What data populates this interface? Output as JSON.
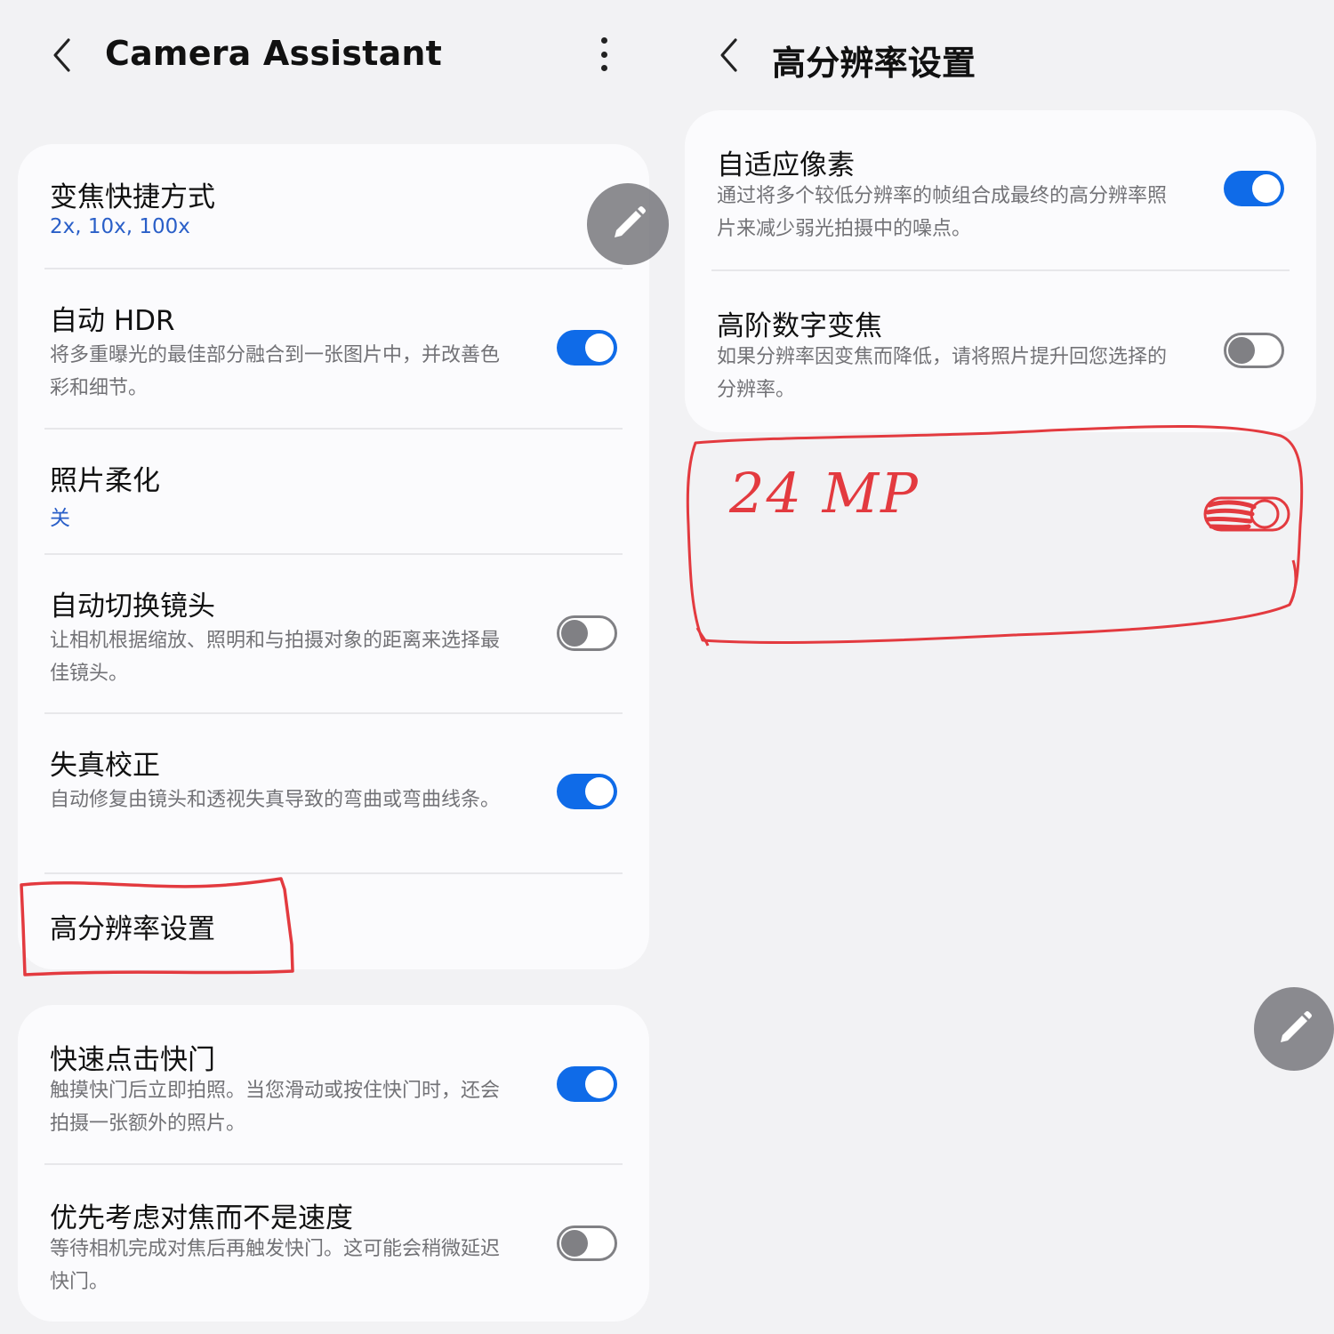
{
  "left": {
    "header": {
      "title": "Camera Assistant"
    },
    "card1": {
      "zoom": {
        "title": "变焦快捷方式",
        "value": "2x, 10x, 100x"
      },
      "hdr": {
        "title": "自动 HDR",
        "desc": "将多重曝光的最佳部分融合到一张图片中，并改善色彩和细节。",
        "toggle": "on"
      },
      "soften": {
        "title": "照片柔化",
        "value": "关"
      },
      "lens": {
        "title": "自动切换镜头",
        "desc": "让相机根据缩放、照明和与拍摄对象的距离来选择最佳镜头。",
        "toggle": "off"
      },
      "distortion": {
        "title": "失真校正",
        "desc": "自动修复由镜头和透视失真导致的弯曲或弯曲线条。",
        "toggle": "on"
      },
      "hires": {
        "title": "高分辨率设置"
      }
    },
    "card2": {
      "quick_shutter": {
        "title": "快速点击快门",
        "desc": "触摸快门后立即拍照。当您滑动或按住快门时，还会拍摄一张额外的照片。",
        "toggle": "on"
      },
      "focus_priority": {
        "title": "优先考虑对焦而不是速度",
        "desc": "等待相机完成对焦后再触发快门。这可能会稍微延迟快门。",
        "toggle": "off"
      }
    }
  },
  "right": {
    "header": {
      "title": "高分辨率设置"
    },
    "card": {
      "adaptive": {
        "title": "自适应像素",
        "desc": "通过将多个较低分辨率的帧组合成最终的高分辨率照片来减少弱光拍摄中的噪点。",
        "toggle": "on"
      },
      "digital_zoom": {
        "title": "高阶数字变焦",
        "desc": "如果分辨率因变焦而降低，请将照片提升回您选择的分辨率。",
        "toggle": "off"
      }
    },
    "annotation": {
      "text": "24 MP"
    }
  },
  "colors": {
    "accent": "#0f6be8",
    "link": "#2a5fc8",
    "annotation": "#e33a3f",
    "background": "#f2f2f4",
    "card": "#fbfbfd"
  },
  "icons": [
    "back-icon",
    "more-vert-icon",
    "pencil-icon"
  ]
}
